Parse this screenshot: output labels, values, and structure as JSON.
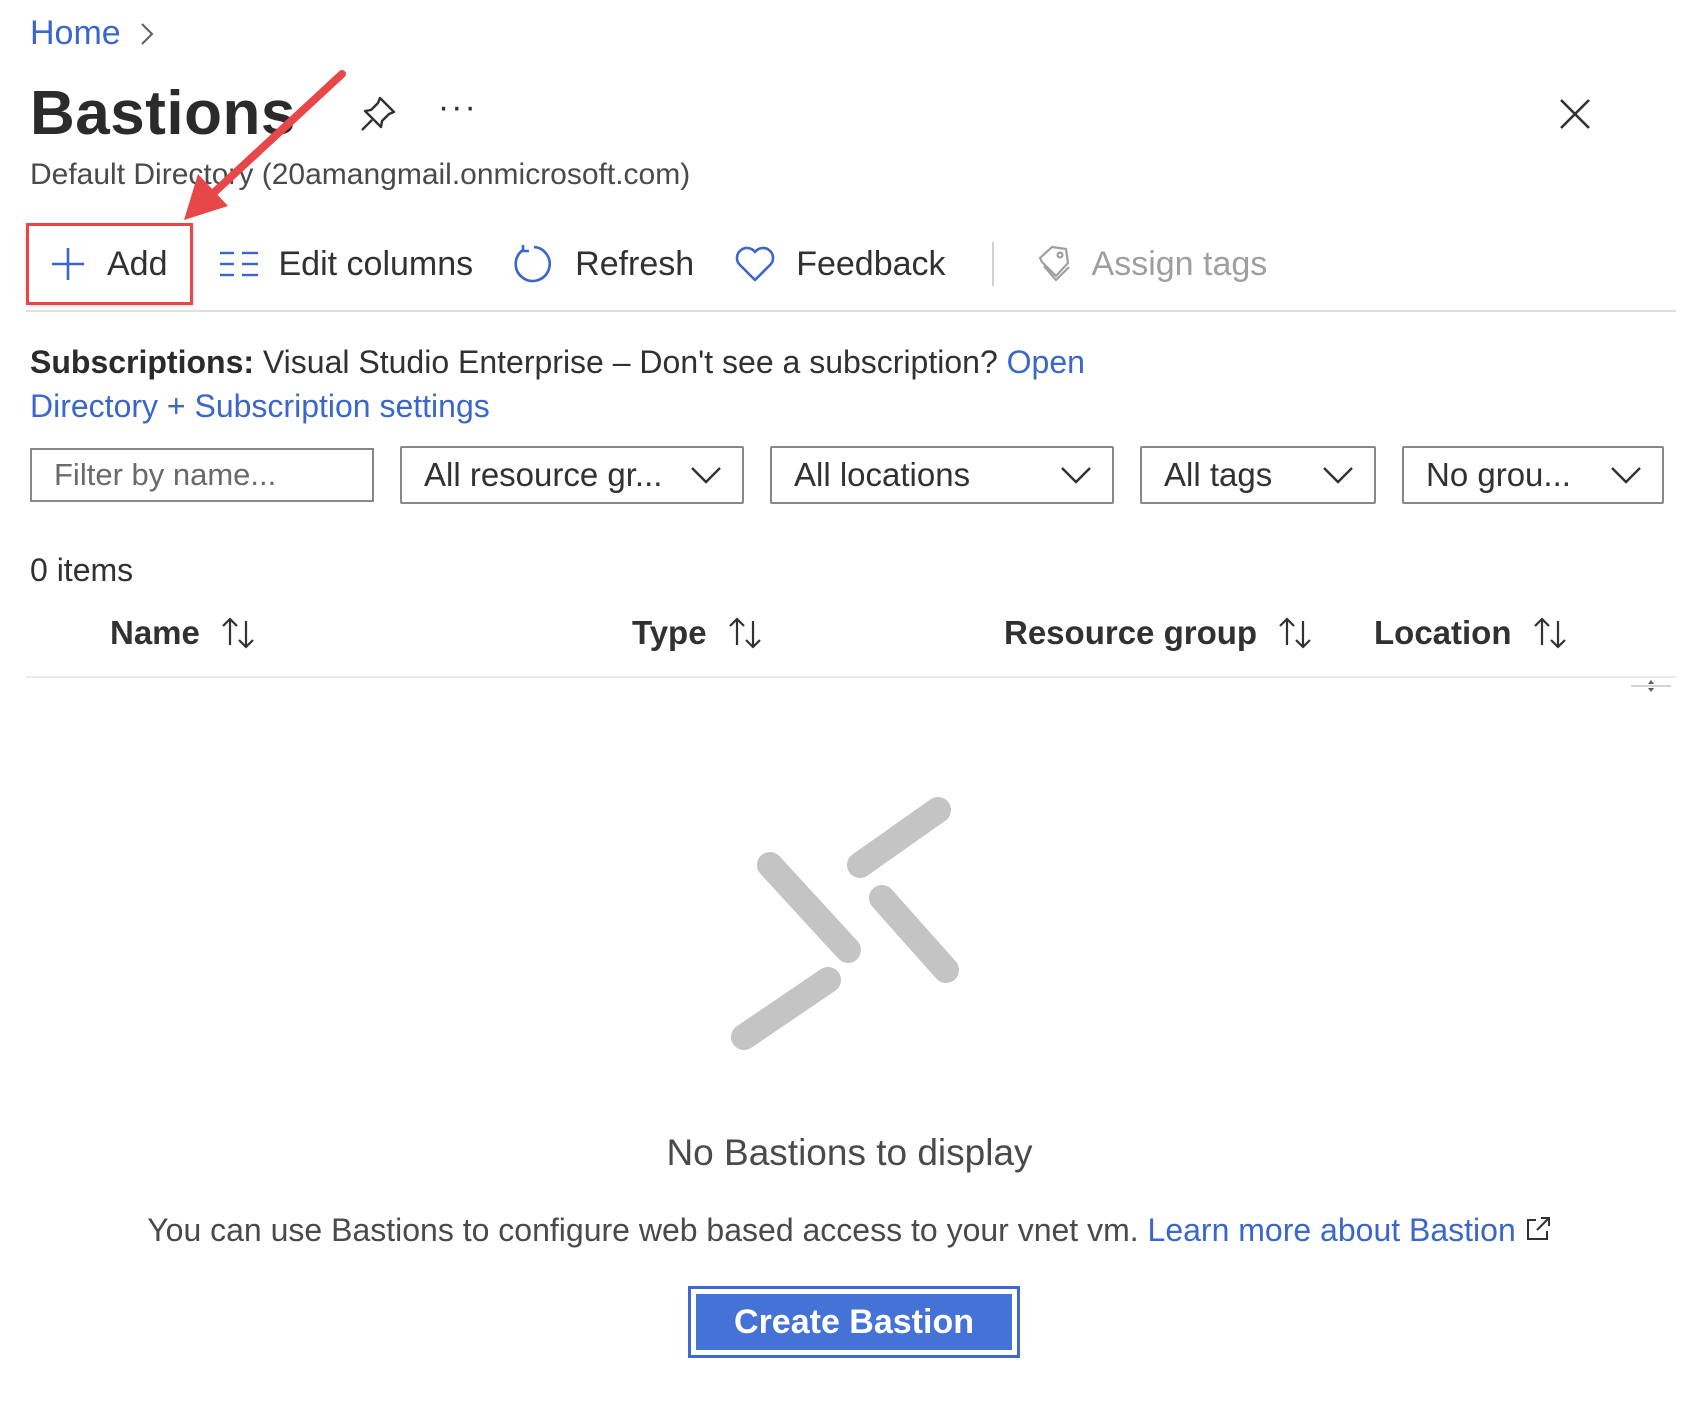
{
  "breadcrumb": {
    "home": "Home"
  },
  "header": {
    "title": "Bastions",
    "more": "···",
    "subtitle": "Default Directory (20amangmail.onmicrosoft.com)"
  },
  "toolbar": {
    "add": "Add",
    "edit_columns": "Edit columns",
    "refresh": "Refresh",
    "feedback": "Feedback",
    "assign_tags": "Assign tags"
  },
  "subscriptions": {
    "label": "Subscriptions:",
    "text": "Visual Studio Enterprise – Don't see a subscription?",
    "link": "Open Directory + Subscription settings"
  },
  "filters": {
    "name_placeholder": "Filter by name...",
    "resource_group": "All resource gr...",
    "locations": "All locations",
    "tags": "All tags",
    "grouping": "No grou..."
  },
  "list": {
    "count": "0 items",
    "columns": [
      "Name",
      "Type",
      "Resource group",
      "Location"
    ]
  },
  "empty_state": {
    "title": "No Bastions to display",
    "description": "You can use Bastions to configure web based access to your vnet vm.",
    "learn_more": "Learn more about Bastion",
    "create_button": "Create Bastion"
  },
  "colors": {
    "accent": "#3a67c8",
    "primary_button": "#4472d6",
    "annotation": "#e8474a"
  },
  "icons": [
    "chevron-right-icon",
    "pin-icon",
    "more-icon",
    "close-icon",
    "plus-icon",
    "edit-columns-icon",
    "refresh-icon",
    "heart-icon",
    "tag-icon",
    "chevron-down-icon",
    "sort-icon",
    "external-link-icon",
    "bastion-empty-icon"
  ]
}
